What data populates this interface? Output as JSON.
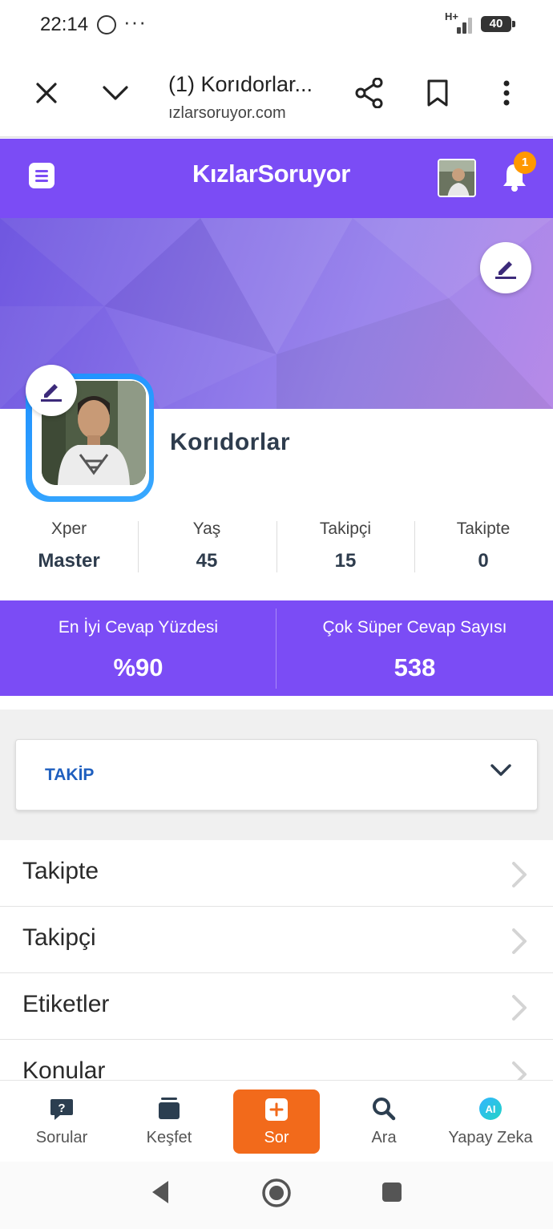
{
  "status_bar": {
    "time": "22:14",
    "dots": "···",
    "network": "H+",
    "battery": "40"
  },
  "browser": {
    "tab_title": "(1) Korıdorlar...",
    "url": "ızlarsoruyor.com"
  },
  "site": {
    "logo": "KızlarSoruyor",
    "notification_count": "1",
    "accent_color": "#7b4cf5"
  },
  "profile": {
    "username": "Korıdorlar",
    "stats": [
      {
        "label": "Xper",
        "value": "Master"
      },
      {
        "label": "Yaş",
        "value": "45"
      },
      {
        "label": "Takipçi",
        "value": "15"
      },
      {
        "label": "Takipte",
        "value": "0"
      }
    ],
    "highlights": [
      {
        "label": "En İyi Cevap Yüzdesi",
        "value": "%90"
      },
      {
        "label": "Çok Süper Cevap Sayısı",
        "value": "538"
      }
    ]
  },
  "takip_section": {
    "label": "TAKİP"
  },
  "menu_items": [
    {
      "label": "Takipte"
    },
    {
      "label": "Takipçi"
    },
    {
      "label": "Etiketler"
    },
    {
      "label": "Konular"
    }
  ],
  "bottom_nav": [
    {
      "label": "Sorular",
      "icon": "question-bubble-icon"
    },
    {
      "label": "Keşfet",
      "icon": "stack-icon"
    },
    {
      "label": "Sor",
      "icon": "plus-icon"
    },
    {
      "label": "Ara",
      "icon": "search-icon"
    },
    {
      "label": "Yapay Zeka",
      "icon": "ai-icon"
    }
  ]
}
